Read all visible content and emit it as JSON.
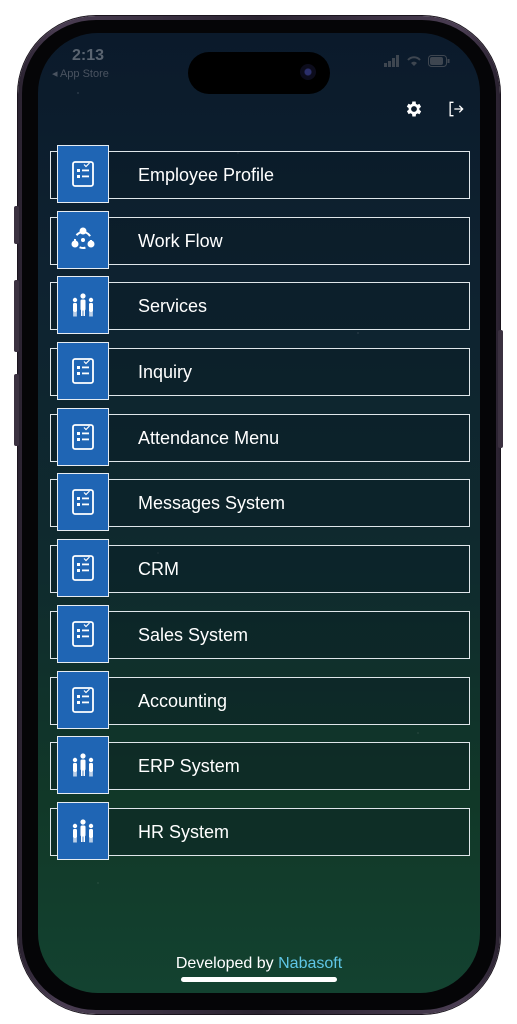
{
  "status_bar": {
    "time": "2:13",
    "back_label": "◂ App Store"
  },
  "header": {
    "settings_icon": "gear-icon",
    "logout_icon": "logout-icon"
  },
  "menu": {
    "items": [
      {
        "label": "Employee Profile",
        "icon": "checklist-icon"
      },
      {
        "label": "Work Flow",
        "icon": "workflow-icon"
      },
      {
        "label": "Services",
        "icon": "team-icon"
      },
      {
        "label": "Inquiry",
        "icon": "checklist-icon"
      },
      {
        "label": "Attendance Menu",
        "icon": "checklist-icon"
      },
      {
        "label": "Messages System",
        "icon": "checklist-icon"
      },
      {
        "label": "CRM",
        "icon": "checklist-icon"
      },
      {
        "label": "Sales System",
        "icon": "checklist-icon"
      },
      {
        "label": "Accounting",
        "icon": "checklist-icon"
      },
      {
        "label": "ERP System",
        "icon": "team-icon"
      },
      {
        "label": "HR System",
        "icon": "team-icon"
      }
    ]
  },
  "footer": {
    "prefix": "Developed by",
    "brand": "Nabasoft"
  },
  "colors": {
    "icon_box": "#1f65b4",
    "brand_link": "#5fc6e6",
    "border": "#dfe6ea"
  }
}
